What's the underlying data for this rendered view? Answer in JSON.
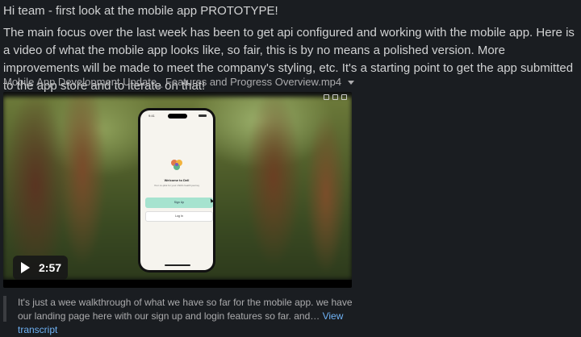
{
  "message": {
    "greeting": "Hi team - first look at the mobile app PROTOTYPE!",
    "body": "The main focus over the last week has been to get api configured and working with the mobile app. Here is a video of what the mobile app looks like, so fair, this is by no means a polished version. More improvements will be made to meet the company's styling, etc. It's a starting point to get the app submitted to the app store and to iterate on that!"
  },
  "attachment": {
    "filename": "Mobile App Development Update_ Features and Progress Overview.mp4",
    "dropdown_icon": "caret-down-icon"
  },
  "video": {
    "duration": "2:57",
    "play_icon": "play-icon",
    "phone": {
      "status_time": "9:41",
      "welcome": "Welcome to Dell",
      "tagline": "Your co-pilot for your child's health journey",
      "sign_up": "Sign Up",
      "log_in": "Log In"
    }
  },
  "transcript": {
    "text": "It's just a wee walkthrough of what we have so far for the mobile app. we have our landing page here with our sign up and login features so far. and…",
    "link": "View transcript"
  }
}
